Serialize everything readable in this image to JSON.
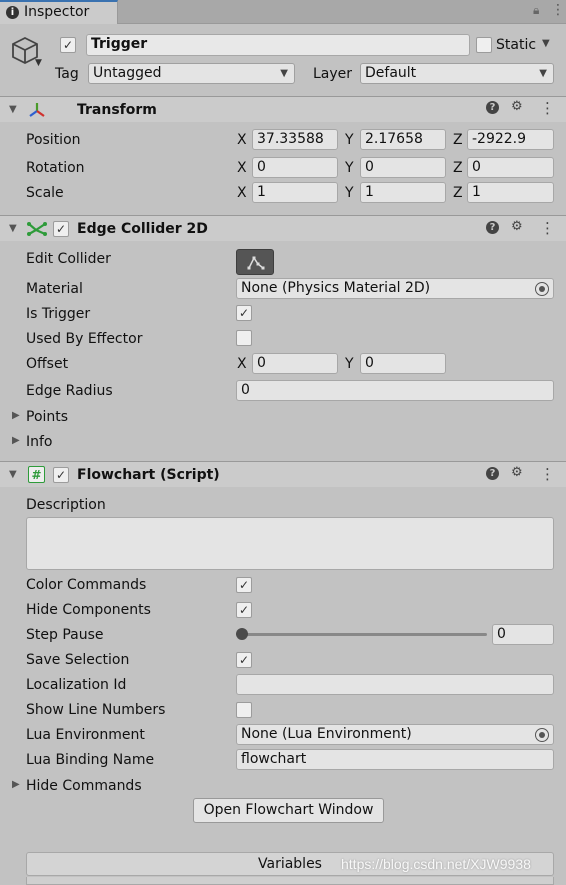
{
  "tab": {
    "label": "Inspector"
  },
  "object": {
    "name": "Trigger",
    "active": true,
    "static_label": "Static",
    "tag_label": "Tag",
    "tag_value": "Untagged",
    "layer_label": "Layer",
    "layer_value": "Default"
  },
  "transform": {
    "title": "Transform",
    "position_label": "Position",
    "rotation_label": "Rotation",
    "scale_label": "Scale",
    "position": {
      "x": "37.33588",
      "y": "2.17658",
      "z": "-2922.9"
    },
    "rotation": {
      "x": "0",
      "y": "0",
      "z": "0"
    },
    "scale": {
      "x": "1",
      "y": "1",
      "z": "1"
    }
  },
  "edge_collider": {
    "title": "Edge Collider 2D",
    "edit_collider_label": "Edit Collider",
    "material_label": "Material",
    "material_value": "None (Physics Material 2D)",
    "is_trigger_label": "Is Trigger",
    "used_by_effector_label": "Used By Effector",
    "offset_label": "Offset",
    "offset": {
      "x": "0",
      "y": "0"
    },
    "edge_radius_label": "Edge Radius",
    "edge_radius_value": "0",
    "points_label": "Points",
    "info_label": "Info"
  },
  "flowchart": {
    "title": "Flowchart (Script)",
    "description_label": "Description",
    "description_value": "",
    "color_commands_label": "Color Commands",
    "hide_components_label": "Hide Components",
    "step_pause_label": "Step Pause",
    "step_pause_value": "0",
    "save_selection_label": "Save Selection",
    "localization_id_label": "Localization Id",
    "localization_id_value": "",
    "show_line_numbers_label": "Show Line Numbers",
    "lua_environment_label": "Lua Environment",
    "lua_environment_value": "None (Lua Environment)",
    "lua_binding_name_label": "Lua Binding Name",
    "lua_binding_name_value": "flowchart",
    "hide_commands_label": "Hide Commands",
    "open_window_button": "Open Flowchart Window",
    "variables_label": "Variables"
  },
  "axis_labels": {
    "x": "X",
    "y": "Y",
    "z": "Z"
  },
  "watermark": "https://blog.csdn.net/XJW9938",
  "colors": {
    "background": "#c2c2c2",
    "header": "#cbcbcb",
    "field": "#e4e4e4",
    "tab": "#d6d6d6",
    "transform_icon_red": "#d0312d",
    "transform_icon_green": "#4a9a2a",
    "transform_icon_blue": "#2d5fd0",
    "collider_icon_green": "#2e9b3a"
  }
}
